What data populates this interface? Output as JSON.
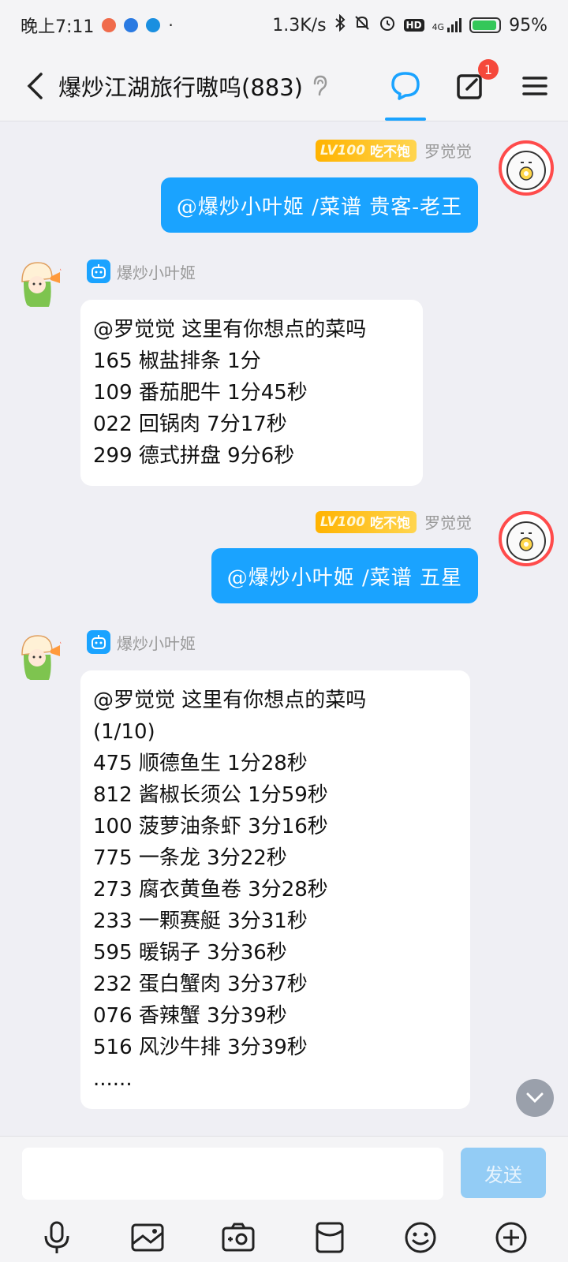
{
  "status_bar": {
    "time": "晚上7:11",
    "net_speed": "1.3K/s",
    "network": "4G",
    "hd": "HD",
    "battery": "95%",
    "battery_level": 0.95
  },
  "header": {
    "title": "爆炒江湖旅行嗷呜(883)",
    "notification_count": "1"
  },
  "messages": [
    {
      "type": "sent",
      "level": "LV100",
      "level_title": "吃不饱",
      "sender": "罗觉觉",
      "text": "@爆炒小叶姬 /菜谱 贵客-老王"
    },
    {
      "type": "bot",
      "sender": "爆炒小叶姬",
      "lines": [
        "@罗觉觉 这里有你想点的菜吗",
        "165 椒盐排条 1分",
        "109 番茄肥牛 1分45秒",
        "022 回锅肉 7分17秒",
        "299 德式拼盘 9分6秒"
      ]
    },
    {
      "type": "sent",
      "level": "LV100",
      "level_title": "吃不饱",
      "sender": "罗觉觉",
      "text": "@爆炒小叶姬 /菜谱 五星"
    },
    {
      "type": "bot",
      "sender": "爆炒小叶姬",
      "lines": [
        "@罗觉觉 这里有你想点的菜吗",
        "(1/10)",
        "475 顺德鱼生 1分28秒",
        "812 酱椒长须公 1分59秒",
        "100 菠萝油条虾 3分16秒",
        "775 一条龙 3分22秒",
        "273 腐衣黄鱼卷 3分28秒",
        "233 一颗赛艇 3分31秒",
        "595 暖锅子 3分36秒",
        "232 蛋白蟹肉 3分37秒",
        "076 香辣蟹 3分39秒",
        "516 风沙牛排 3分39秒",
        "......"
      ]
    }
  ],
  "input": {
    "value": "",
    "send_label": "发送"
  },
  "icons": {
    "toolbar": [
      "microphone-icon",
      "image-icon",
      "camera-icon",
      "red-packet-icon",
      "emoji-icon",
      "plus-icon"
    ]
  },
  "colors": {
    "accent": "#1aa3ff",
    "level_badge": "#ffb300",
    "badge_red": "#f5483b",
    "background": "#efeff4"
  }
}
